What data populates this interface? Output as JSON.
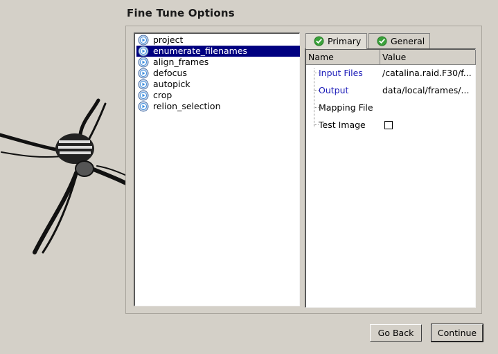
{
  "page": {
    "title": "Fine Tune Options"
  },
  "tasks": [
    {
      "label": "project",
      "selected": false
    },
    {
      "label": "enumerate_filenames",
      "selected": true
    },
    {
      "label": "align_frames",
      "selected": false
    },
    {
      "label": "defocus",
      "selected": false
    },
    {
      "label": "autopick",
      "selected": false
    },
    {
      "label": "crop",
      "selected": false
    },
    {
      "label": "relion_selection",
      "selected": false
    }
  ],
  "tabs": [
    {
      "label": "Primary",
      "active": true,
      "icon": "check-circle-icon"
    },
    {
      "label": "General",
      "active": false,
      "icon": "check-circle-icon"
    }
  ],
  "table": {
    "headers": {
      "name": "Name",
      "value": "Value"
    },
    "rows": [
      {
        "name": "Input Files",
        "value": "/catalina.raid.F30/f...",
        "is_link": true
      },
      {
        "name": "Output",
        "value": "data/local/frames/...",
        "is_link": true
      },
      {
        "name": "Mapping File",
        "value": "",
        "is_link": false
      },
      {
        "name": "Test Image",
        "value": "",
        "is_link": false,
        "checkbox": false
      }
    ]
  },
  "buttons": {
    "back": "Go Back",
    "continue": "Continue"
  },
  "colors": {
    "background": "#d4d0c8",
    "selection": "#000080",
    "link": "#1a1ab8",
    "check_green": "#3aa13a"
  }
}
